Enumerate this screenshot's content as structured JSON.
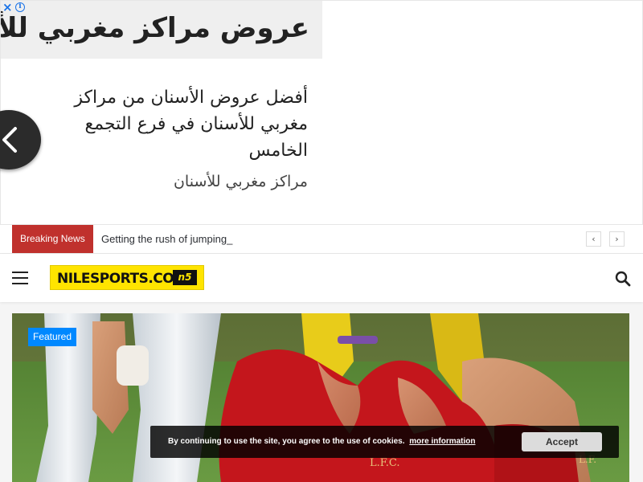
{
  "ad": {
    "close_icon": "×",
    "info_icon": "i",
    "title": "عروض مراكز مغربي للأسنان",
    "description": "أفضل عروض الأسنان من مراكز مغربي للأسنان في فرع التجمع الخامس",
    "advertiser": "مراكز مغربي للأسنان"
  },
  "breaking": {
    "label": "Breaking News",
    "headline": "Getting the rush of jumping_",
    "prev_icon": "‹",
    "next_icon": "›"
  },
  "header": {
    "logo_text": "NILESPORTS.COM",
    "logo_badge": "n5"
  },
  "featured": {
    "tag": "Featured"
  },
  "cookie": {
    "text": "By continuing to use the site, you agree to the use of cookies.",
    "link": "more information",
    "accept": "Accept"
  }
}
